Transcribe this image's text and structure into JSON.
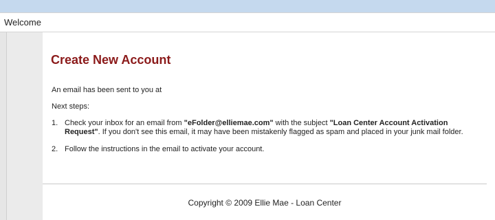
{
  "header": {
    "welcome": "Welcome"
  },
  "main": {
    "title": "Create New Account",
    "message": "An email has been sent to you at",
    "next_steps_label": "Next steps:",
    "steps": [
      {
        "number": "1.",
        "t1": "Check your inbox for an email from ",
        "b1": "\"eFolder@elliemae.com\"",
        "t2": " with the subject ",
        "b2": "\"Loan Center Account Activation Request\"",
        "t3": ". If you don't see this email, it may have been mistakenly flagged as spam and placed in your junk mail folder."
      },
      {
        "number": "2.",
        "t1": "Follow the instructions in the email to activate your account."
      }
    ]
  },
  "footer": {
    "copyright": "Copyright © 2009 Ellie Mae - Loan Center"
  },
  "colors": {
    "title": "#8b1a1a",
    "top_strip": "#c5d9ee",
    "gutter": "#ebebeb"
  }
}
